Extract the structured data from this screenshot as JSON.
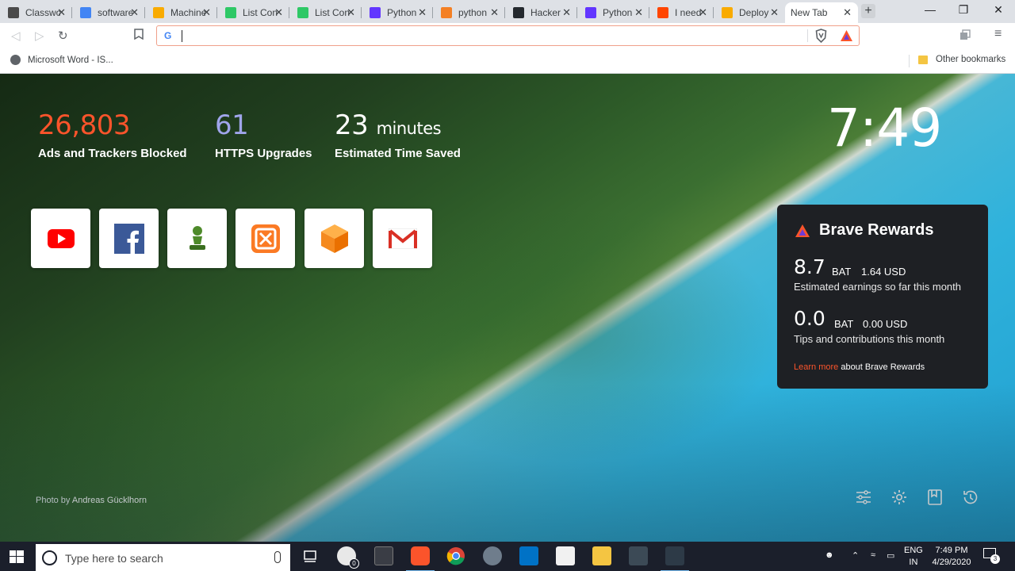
{
  "tabs": [
    {
      "title": "Classwo",
      "icon": "classroom-icon",
      "color": "#4a4a4a"
    },
    {
      "title": "software",
      "icon": "google-icon",
      "color": "#4285f4"
    },
    {
      "title": "Machine",
      "icon": "colab-icon",
      "color": "#f9ab00"
    },
    {
      "title": "List Con",
      "icon": "hackerrank-icon",
      "color": "#2ec866"
    },
    {
      "title": "List Con",
      "icon": "hackerrank-icon",
      "color": "#2ec866"
    },
    {
      "title": "Python",
      "icon": "python-icon",
      "color": "#6236ff"
    },
    {
      "title": "python",
      "icon": "stackoverflow-icon",
      "color": "#f48024"
    },
    {
      "title": "Hacker",
      "icon": "github-icon",
      "color": "#24292e"
    },
    {
      "title": "Python",
      "icon": "python-icon",
      "color": "#6236ff"
    },
    {
      "title": "I need",
      "icon": "reddit-icon",
      "color": "#ff4500"
    },
    {
      "title": "Deploy",
      "icon": "colab-icon",
      "color": "#f9ab00"
    },
    {
      "title": "New Tab",
      "icon": "",
      "color": "#ffffff",
      "active": true
    }
  ],
  "bookmarks": {
    "item": "Microsoft Word - IS...",
    "other": "Other bookmarks"
  },
  "stats": {
    "ads_value": "26,803",
    "ads_label": "Ads and Trackers Blocked",
    "https_value": "61",
    "https_label": "HTTPS Upgrades",
    "time_value": "23",
    "time_unit": "minutes",
    "time_label": "Estimated Time Saved"
  },
  "colors": {
    "ads": "#fb542b",
    "https": "#a0a5eb",
    "time": "#ffffff",
    "brave_orange": "#fb542b",
    "rewards_bg": "#1e2024"
  },
  "clock": "7:49",
  "top_sites": [
    {
      "name": "YouTube",
      "icon": "youtube-icon"
    },
    {
      "name": "Facebook",
      "icon": "facebook-icon"
    },
    {
      "name": "Chess",
      "icon": "chess-pawn-icon"
    },
    {
      "name": "XAMPP",
      "icon": "xampp-icon"
    },
    {
      "name": "Cube",
      "icon": "cube-icon"
    },
    {
      "name": "Gmail",
      "icon": "gmail-icon"
    }
  ],
  "rewards": {
    "title": "Brave Rewards",
    "earnings_amount": "8.7",
    "earnings_unit": "BAT",
    "earnings_usd": "1.64 USD",
    "earnings_desc": "Estimated earnings so far this month",
    "tips_amount": "0.0",
    "tips_unit": "BAT",
    "tips_usd": "0.00 USD",
    "tips_desc": "Tips and contributions this month",
    "learn_more": "Learn more",
    "learn_more_suffix": "about Brave Rewards"
  },
  "photo_credit": {
    "prefix": "Photo by",
    "author": "Andreas Gücklhorn"
  },
  "taskbar": {
    "search_placeholder": "Type here to search",
    "lang_top": "ENG",
    "lang_bottom": "IN",
    "time": "7:49 PM",
    "date": "4/29/2020",
    "notifications": "3",
    "badge": "0"
  }
}
